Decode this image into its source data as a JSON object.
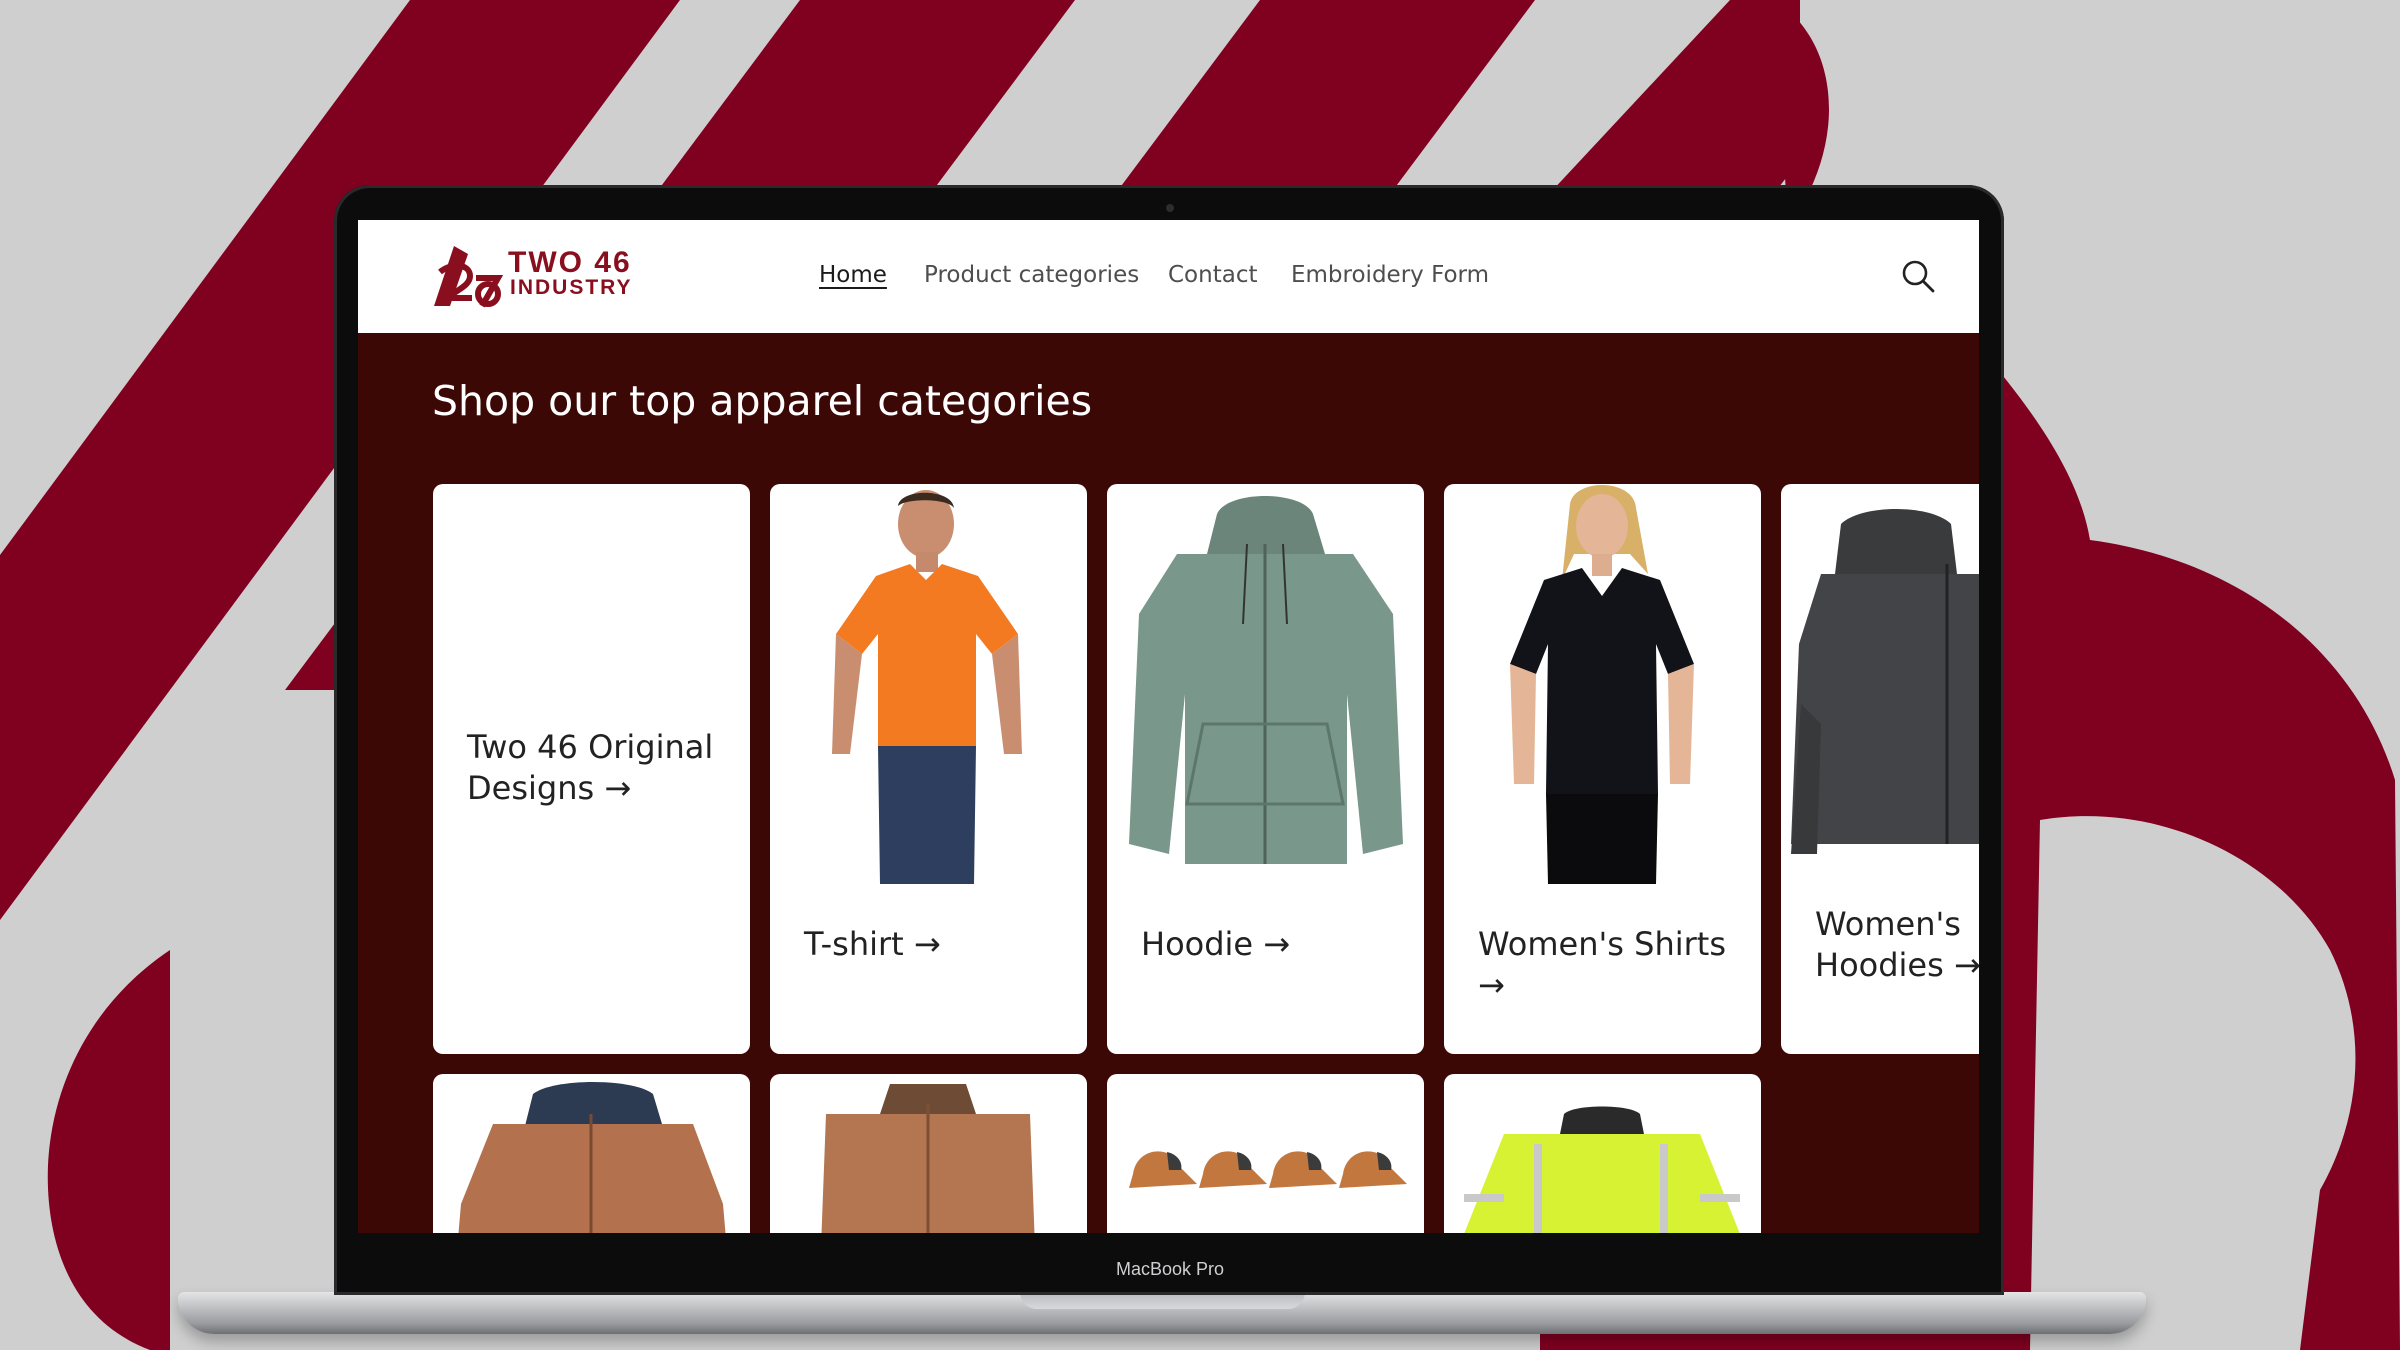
{
  "device": {
    "label": "MacBook Pro"
  },
  "site": {
    "logo": {
      "line1": "TWO 46",
      "line2": "INDUSTRY"
    },
    "nav": [
      {
        "label": "Home",
        "active": true
      },
      {
        "label": "Product categories",
        "active": false
      },
      {
        "label": "Contact",
        "active": false
      },
      {
        "label": "Embroidery Form",
        "active": false
      }
    ],
    "search_icon": "search-icon"
  },
  "section": {
    "title": "Shop our top apparel categories",
    "categories": [
      {
        "label": "Two 46 Original Designs →",
        "image": "none"
      },
      {
        "label": "T-shirt →",
        "image": "orange-tshirt-model"
      },
      {
        "label": "Hoodie →",
        "image": "green-zip-hoodie"
      },
      {
        "label": "Women's Shirts →",
        "image": "black-polo-model"
      },
      {
        "label": "Women's Hoodies →",
        "image": "charcoal-zip-hoodie"
      }
    ],
    "row2": [
      {
        "image": "brown-hooded-jacket"
      },
      {
        "image": "brown-vest"
      },
      {
        "image": "trucker-caps"
      },
      {
        "image": "hi-vis-jacket"
      }
    ]
  },
  "colors": {
    "brand": "#8a0f1e",
    "section_bg": "#3c0806",
    "backdrop": "#cfcfcf"
  }
}
